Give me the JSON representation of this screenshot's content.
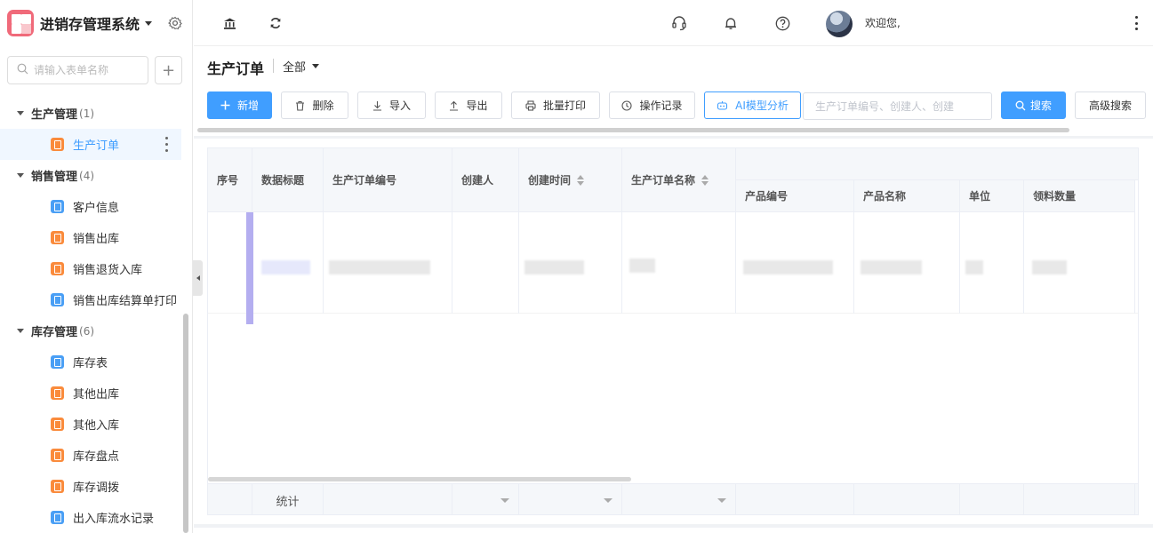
{
  "app": {
    "title": "进销存管理系统",
    "brand_color": "#f06a7a",
    "accent_color": "#409eff"
  },
  "sidebar": {
    "search_placeholder": "请输入表单名称",
    "add_label": "+",
    "groups": [
      {
        "label": "生产管理",
        "count": "(1)",
        "items": [
          {
            "label": "生产订单",
            "icon": "form-icon-orange",
            "active": true
          }
        ]
      },
      {
        "label": "销售管理",
        "count": "(4)",
        "items": [
          {
            "label": "客户信息",
            "icon": "form-icon-blue"
          },
          {
            "label": "销售出库",
            "icon": "form-icon-orange"
          },
          {
            "label": "销售退货入库",
            "icon": "form-icon-orange"
          },
          {
            "label": "销售出库结算单打印",
            "icon": "form-icon-blue"
          }
        ]
      },
      {
        "label": "库存管理",
        "count": "(6)",
        "items": [
          {
            "label": "库存表",
            "icon": "form-icon-blue"
          },
          {
            "label": "其他出库",
            "icon": "form-icon-orange"
          },
          {
            "label": "其他入库",
            "icon": "form-icon-orange"
          },
          {
            "label": "库存盘点",
            "icon": "form-icon-orange"
          },
          {
            "label": "库存调拨",
            "icon": "form-icon-orange"
          },
          {
            "label": "出入库流水记录",
            "icon": "form-icon-blue"
          }
        ]
      }
    ]
  },
  "topbar": {
    "icons": [
      "bank-icon",
      "refresh-icon",
      "headset-icon",
      "bell-icon",
      "help-icon"
    ],
    "welcome": "欢迎您,"
  },
  "page": {
    "title": "生产订单",
    "view": "全部"
  },
  "toolbar": {
    "add": "新增",
    "delete": "删除",
    "import": "导入",
    "export": "导出",
    "batch_print": "批量打印",
    "history": "操作记录",
    "ai": "AI模型分析",
    "search_placeholder": "生产订单编号、创建人、创建",
    "search": "搜索",
    "advanced_search": "高级搜索"
  },
  "table": {
    "columns": {
      "index": "序号",
      "data_title": "数据标题",
      "order_no": "生产订单编号",
      "creator": "创建人",
      "created_at": "创建时间",
      "order_name": "生产订单名称",
      "product_no": "产品编号",
      "product_name": "产品名称",
      "unit": "单位",
      "pick_qty": "领料数量"
    },
    "footer": {
      "stat_label": "统计"
    }
  }
}
